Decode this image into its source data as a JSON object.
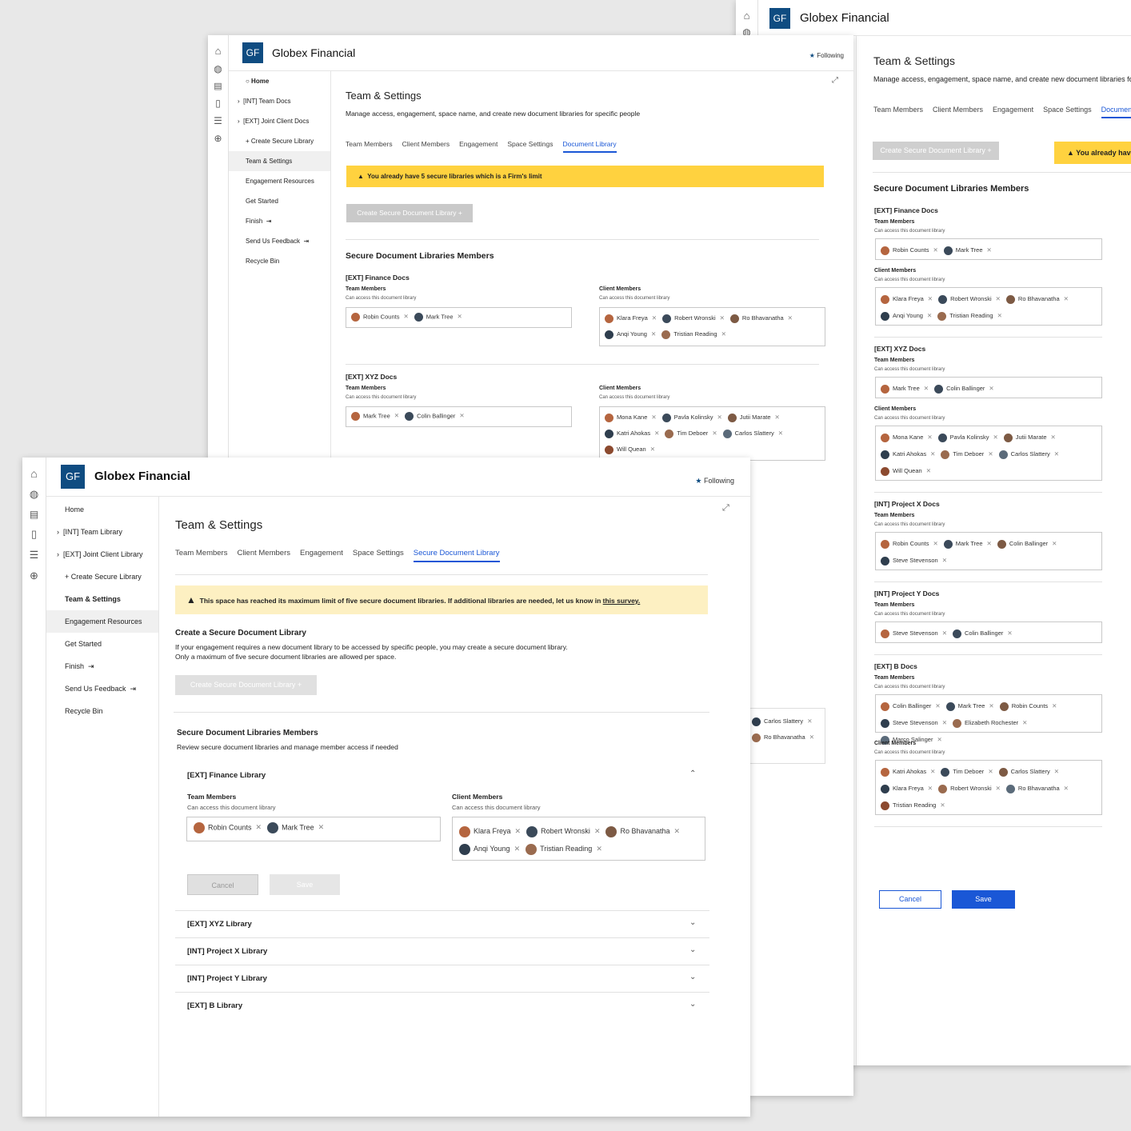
{
  "brand": {
    "logo": "GF",
    "name": "Globex Financial"
  },
  "following": "Following",
  "page_title": "Team & Settings",
  "page_desc": "Manage access, engagement, space name, and create new document libraries for specific people",
  "tabs": [
    "Team Members",
    "Client Members",
    "Engagement",
    "Space Settings",
    "Document Library"
  ],
  "tabs_front": [
    "Team Members",
    "Client Members",
    "Engagement",
    "Space Settings",
    "Secure Document Library"
  ],
  "warn_mid": "You already have 5 secure libraries which is a Firm's limit",
  "warn_right": "You already have",
  "create_btn": "Create Secure Document Library",
  "section_title": "Secure Document Libraries Members",
  "team_members": "Team Members",
  "client_members": "Client Members",
  "can_access": "Can access this document library",
  "nav_mid": [
    "Home",
    "[INT] Team Docs",
    "[EXT] Joint Client Docs",
    "+ Create Secure Library",
    "Team & Settings",
    "Engagement Resources",
    "Get Started",
    "Finish",
    "Send Us Feedback",
    "Recycle Bin"
  ],
  "nav_front": [
    "Home",
    "[INT] Team Library",
    "[EXT] Joint Client Library",
    "+ Create Secure Library",
    "Team & Settings",
    "Engagement Resources",
    "Get Started",
    "Finish",
    "Send Us Feedback",
    "Recycle Bin"
  ],
  "libs_mid": [
    {
      "name": "[EXT] Finance Docs",
      "team": [
        "Robin Counts",
        "Mark Tree"
      ],
      "client": [
        "Klara Freya",
        "Robert Wronski",
        "Ro Bhavanatha",
        "Anqi Young",
        "Tristian Reading"
      ]
    },
    {
      "name": "[EXT] XYZ Docs",
      "team": [
        "Mark Tree",
        "Colin Ballinger"
      ],
      "client": [
        "Mona Kane",
        "Pavla Kolinsky",
        "Jutii Marate",
        "Katri Ahokas",
        "Tim Deboer",
        "Carlos Slattery",
        "Will Quean"
      ]
    }
  ],
  "libs_right": [
    {
      "name": "[EXT] Finance Docs",
      "team": [
        "Robin Counts",
        "Mark Tree"
      ],
      "client": [
        "Klara Freya",
        "Robert Wronski",
        "Ro Bhavanatha",
        "Anqi Young",
        "Tristian Reading"
      ]
    },
    {
      "name": "[EXT] XYZ Docs",
      "team": [
        "Mark Tree",
        "Colin Ballinger"
      ],
      "client": [
        "Mona Kane",
        "Pavla Kolinsky",
        "Jutii Marate",
        "Katri Ahokas",
        "Tim Deboer",
        "Carlos Slattery",
        "Will Quean"
      ]
    },
    {
      "name": "[INT] Project X Docs",
      "team": [
        "Robin Counts",
        "Mark Tree",
        "Colin Ballinger",
        "Steve Stevenson"
      ]
    },
    {
      "name": "[INT] Project Y Docs",
      "team": [
        "Steve Stevenson",
        "Colin Ballinger"
      ]
    },
    {
      "name": "[EXT] B Docs",
      "team": [
        "Colin Ballinger",
        "Mark Tree",
        "Robin Counts",
        "Steve Stevenson",
        "Elizabeth Rochester",
        "Marco Salinger"
      ],
      "client": [
        "Katri Ahokas",
        "Tim Deboer",
        "Carlos Slattery",
        "Klara Freya",
        "Robert Wronski",
        "Ro Bhavanatha",
        "Tristian Reading"
      ]
    }
  ],
  "peek_chips": [
    "Carlos Slattery",
    "Ro Bhavanatha"
  ],
  "cancel": "Cancel",
  "save": "Save",
  "front": {
    "warn": "This space has reached its maximum limit of five secure document libraries. If additional libraries are needed, let us know in ",
    "warn_link": "this survey.",
    "create_title": "Create a Secure Document Library",
    "create_desc1": "If your engagement requires a new document library to be accessed by specific people, you may create a secure document library.",
    "create_desc2": "Only a maximum of five secure document libraries are allowed per space.",
    "members_title": "Secure Document Libraries Members",
    "members_desc": "Review secure document libraries and manage member access if needed",
    "open_lib": "[EXT] Finance Library",
    "team": [
      "Robin Counts",
      "Mark Tree"
    ],
    "client": [
      "Klara Freya",
      "Robert Wronski",
      "Ro Bhavanatha",
      "Anqi Young",
      "Tristian Reading"
    ],
    "collapsed": [
      "[EXT] XYZ Library",
      "[INT] Project X Library",
      "[INT] Project Y Library",
      "[EXT] B Library"
    ]
  },
  "colors": {
    "accent": "#1a57d6",
    "brand": "#0f4c81",
    "warn": "#ffd23f",
    "warn_soft": "#fdf0c2"
  }
}
